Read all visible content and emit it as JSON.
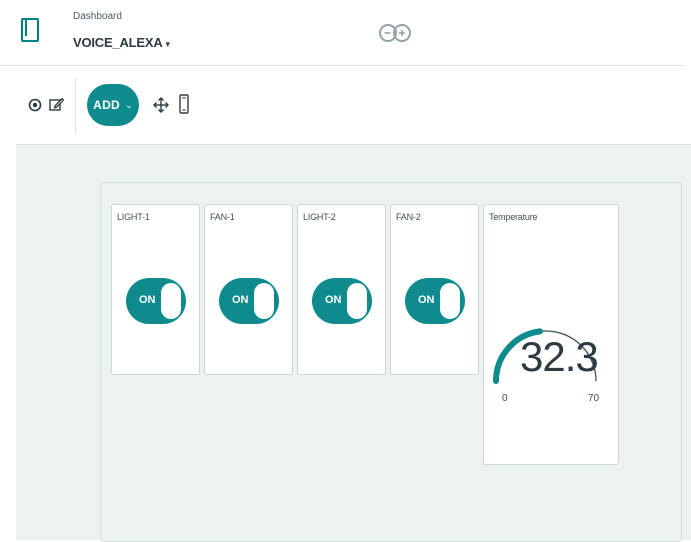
{
  "header": {
    "breadcrumb": "Dashboard",
    "dashboard_name": "VOICE_ALEXA",
    "dashboard_caret": "▾",
    "logo_icon": "arduino-logo-icon",
    "accent_color": "#008184"
  },
  "toolbar": {
    "view_icon": "eye-icon",
    "edit_icon": "pencil-edit-icon",
    "add_label": "ADD",
    "add_chevron": "⌄",
    "arrange_icon": "move-arrows-icon",
    "mobile_icon": "mobile-phone-icon"
  },
  "widgets": {
    "switches": [
      {
        "title": "LIGHT-1",
        "state_label": "ON",
        "state": true
      },
      {
        "title": "FAN-1",
        "state_label": "ON",
        "state": true
      },
      {
        "title": "LIGHT-2",
        "state_label": "ON",
        "state": true
      },
      {
        "title": "FAN-2",
        "state_label": "ON",
        "state": true
      }
    ],
    "gauge": {
      "title": "Temperature",
      "value": "32.3",
      "min": "0",
      "max": "70",
      "value_number": 32.3,
      "min_number": 0,
      "max_number": 70
    }
  },
  "colors": {
    "accent": "#0f8b8d",
    "canvas_bg": "#ecf1f1",
    "gauge_track": "#434f54"
  }
}
